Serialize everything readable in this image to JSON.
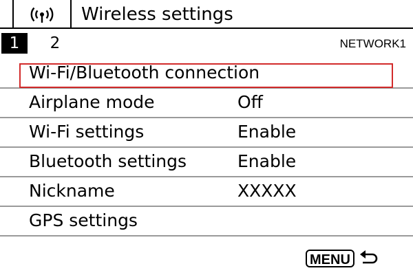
{
  "header": {
    "tab_icon": "wireless-icon",
    "title": "Wireless settings"
  },
  "pages": {
    "tabs": [
      {
        "label": "1",
        "active": true
      },
      {
        "label": "2",
        "active": false
      }
    ],
    "network_label": "NETWORK1"
  },
  "menu": {
    "items": [
      {
        "label": "Wi-Fi/Bluetooth connection",
        "value": "",
        "selected": true
      },
      {
        "label": "Airplane mode",
        "value": "Off",
        "selected": false
      },
      {
        "label": "Wi-Fi settings",
        "value": "Enable",
        "selected": false
      },
      {
        "label": "Bluetooth settings",
        "value": "Enable",
        "selected": false
      },
      {
        "label": "Nickname",
        "value": "XXXXX",
        "selected": false
      },
      {
        "label": "GPS settings",
        "value": "",
        "selected": false
      }
    ]
  },
  "footer": {
    "menu_key_label": "MENU",
    "return_icon": "return-arrow-icon"
  },
  "colors": {
    "selection_border": "#d22a2a",
    "divider": "#9a9a9a"
  }
}
